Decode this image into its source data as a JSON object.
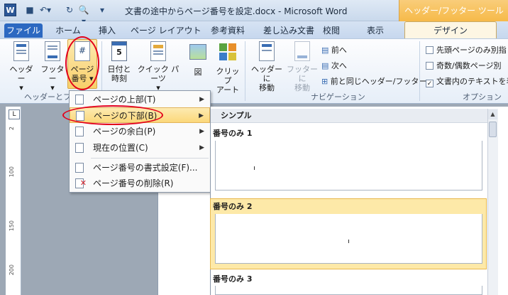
{
  "window": {
    "title": "文書の途中からページ番号を設定.docx - Microsoft Word",
    "app_icon": "W",
    "contextual_group": "ヘッダー/フッター ツール"
  },
  "quick_access": [
    {
      "icon": "save-icon",
      "glyph": "💾"
    },
    {
      "icon": "undo-icon",
      "glyph": "↶"
    },
    {
      "icon": "redo-icon",
      "glyph": "↻"
    },
    {
      "icon": "print-preview-icon",
      "glyph": "🔍"
    }
  ],
  "tabs": {
    "file": "ファイル",
    "home": "ホーム",
    "insert": "挿入",
    "page_layout": "ページ レイアウト",
    "references": "参考資料",
    "mailings": "差し込み文書",
    "review": "校閲",
    "view": "表示",
    "design": "デザイン"
  },
  "ribbon": {
    "header": {
      "line1": "ヘッダー",
      "line2": "▾"
    },
    "footer": {
      "line1": "フッター",
      "line2": "▾"
    },
    "page_number": {
      "line1": "ページ",
      "line2": "番号 ▾"
    },
    "date_time": {
      "line1": "日付と",
      "line2": "時刻"
    },
    "quick_parts": {
      "line1": "クイック パーツ",
      "line2": "▾"
    },
    "picture": {
      "line1": "図"
    },
    "clip_art": {
      "line1": "クリップ",
      "line2": "アート"
    },
    "goto_header": {
      "line1": "ヘッダーに",
      "line2": "移動"
    },
    "goto_footer": {
      "line1": "フッターに",
      "line2": "移動"
    },
    "previous": "前へ",
    "next": "次へ",
    "link_previous": "前と同じヘッダー/フッター",
    "group_header_footer": "ヘッダーとフッ",
    "group_navigation": "ナビゲーション",
    "group_options": "オプション",
    "options": [
      {
        "label": "先頭ページのみ別指",
        "checked": false
      },
      {
        "label": "奇数/偶数ページ別",
        "checked": false
      },
      {
        "label": "文書内のテキストを表",
        "checked": true
      }
    ]
  },
  "ruler": {
    "corner": "L",
    "marks": [
      "2",
      "100",
      "150",
      "200"
    ]
  },
  "page_number_menu": [
    {
      "label": "ページの上部(T)",
      "has_submenu": true,
      "selected": false
    },
    {
      "label": "ページの下部(B)",
      "has_submenu": true,
      "selected": true
    },
    {
      "label": "ページの余白(P)",
      "has_submenu": true,
      "selected": false
    },
    {
      "label": "現在の位置(C)",
      "has_submenu": true,
      "selected": false
    },
    {
      "label": "ページ番号の書式設定(F)...",
      "has_submenu": false,
      "selected": false
    },
    {
      "label": "ページ番号の削除(R)",
      "has_submenu": false,
      "selected": false
    }
  ],
  "gallery": {
    "heading": "シンプル",
    "items": [
      {
        "title": "番号のみ 1",
        "selected": false
      },
      {
        "title": "番号のみ 2",
        "selected": true
      },
      {
        "title": "番号のみ 3",
        "selected": false
      }
    ]
  },
  "colors": {
    "accent_blue": "#2c68c1",
    "contextual_orange": "#f6b845",
    "highlight": "#fbd87a",
    "annotation_red": "#e3001b"
  }
}
